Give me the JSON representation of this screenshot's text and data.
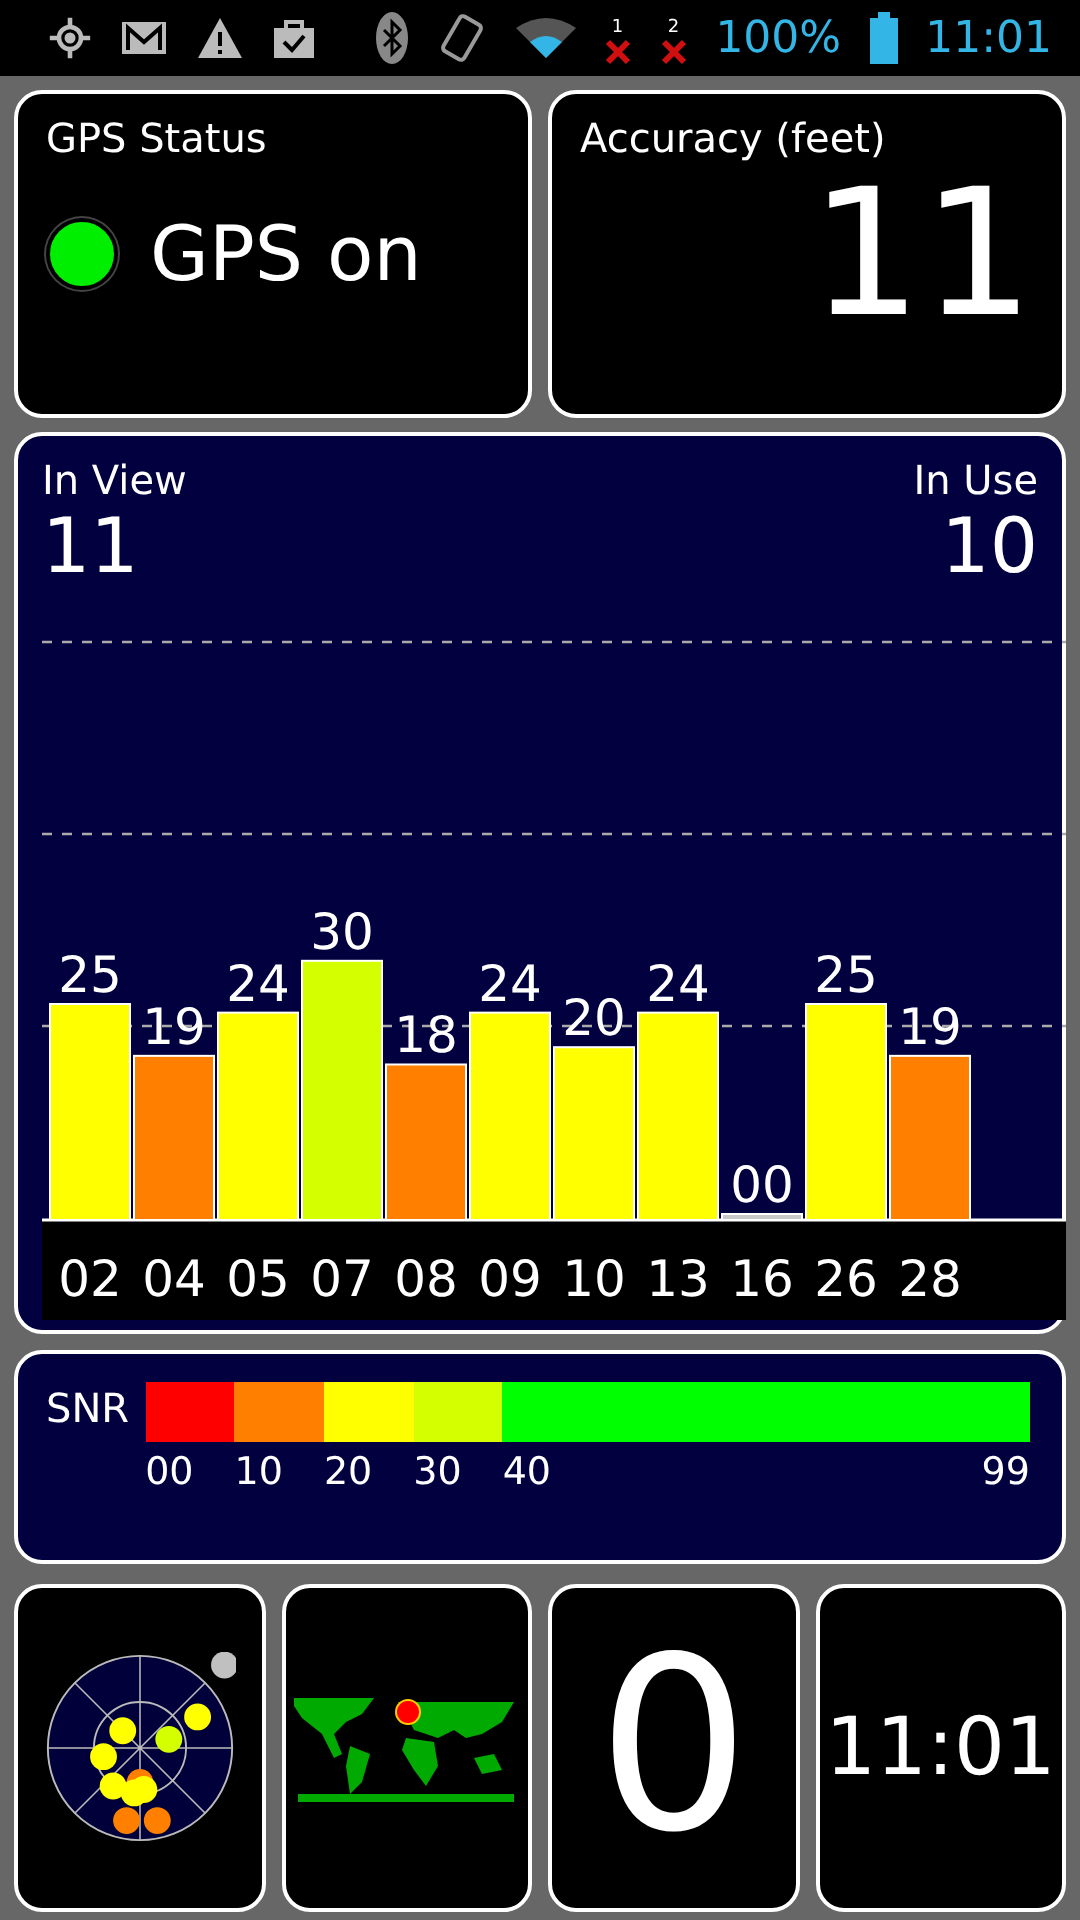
{
  "status_bar": {
    "sim_slots": [
      "1",
      "2"
    ],
    "battery": "100%",
    "time": "11:01"
  },
  "gps_status": {
    "title": "GPS Status",
    "state": "GPS on",
    "on": true
  },
  "accuracy": {
    "title": "Accuracy (feet)",
    "value": "11"
  },
  "satellites": {
    "in_view_label": "In View",
    "in_view": "11",
    "in_use_label": "In Use",
    "in_use": "10",
    "chart_data": {
      "type": "bar",
      "categories": [
        "02",
        "04",
        "05",
        "07",
        "08",
        "09",
        "10",
        "13",
        "16",
        "26",
        "28"
      ],
      "values": [
        25,
        19,
        24,
        30,
        18,
        24,
        20,
        24,
        0,
        25,
        19
      ],
      "value_labels": [
        "25",
        "19",
        "24",
        "30",
        "18",
        "24",
        "20",
        "24",
        "00",
        "25",
        "19"
      ]
    }
  },
  "snr": {
    "label": "SNR",
    "segments": [
      {
        "color": "#ff0000",
        "label": "00"
      },
      {
        "color": "#ff8000",
        "label": "10"
      },
      {
        "color": "#ffff00",
        "label": "20"
      },
      {
        "color": "#d4ff00",
        "label": "30"
      },
      {
        "color": "#00ff00",
        "label": "40"
      }
    ],
    "end_label": "99"
  },
  "tiles": {
    "count": "0",
    "clock": "11:01"
  }
}
